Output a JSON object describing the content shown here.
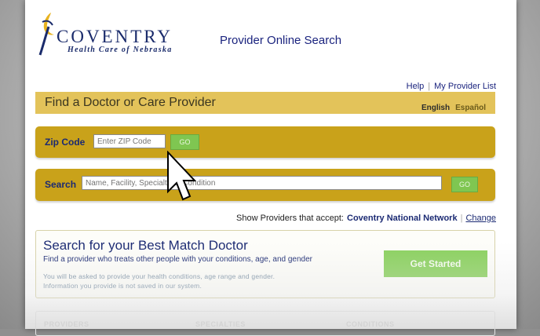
{
  "brand": {
    "name": "COVENTRY",
    "tagline": "Health Care of Nebraska",
    "app_title": "Provider Online Search"
  },
  "top_links": {
    "help": "Help",
    "my_provider_list": "My Provider List"
  },
  "find_bar": {
    "title": "Find a Doctor or Care Provider",
    "lang_english": "English",
    "lang_spanish": "Español"
  },
  "zip": {
    "label": "Zip Code",
    "placeholder": "Enter ZIP Code",
    "go": "GO"
  },
  "search": {
    "label": "Search",
    "placeholder": "Name, Facility, Specialty or Condition",
    "go": "GO"
  },
  "network": {
    "prefix": "Show Providers that accept:",
    "name": "Coventry National Network",
    "change": "Change"
  },
  "best_match": {
    "title": "Search for your Best Match Doctor",
    "description": "Find a provider who treats other people with your conditions, age, and gender",
    "note_line1": "You will be asked to provide your health conditions, age range and gender.",
    "note_line2": "Information you provide is not saved in our system.",
    "button": "Get Started"
  },
  "tabs": [
    "PROVIDERS",
    "SPECIALTIES",
    "CONDITIONS"
  ],
  "colors": {
    "brand_navy": "#1a2b6b",
    "bar_gold": "#c9a21a",
    "find_bar_gold": "#e3c35a",
    "go_green": "#7fc651"
  }
}
